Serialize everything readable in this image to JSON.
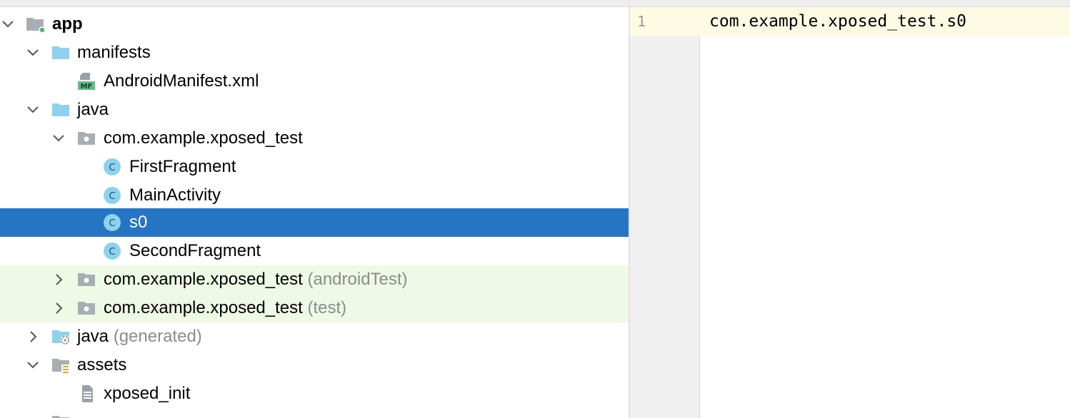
{
  "tree": {
    "rows": [
      {
        "label": "app",
        "suffix": "",
        "icon": "module-folder-icon",
        "expanded": true
      },
      {
        "label": "manifests",
        "suffix": "",
        "icon": "folder-icon",
        "expanded": true
      },
      {
        "label": "AndroidManifest.xml",
        "suffix": "",
        "icon": "manifest-file-icon",
        "badge": "MF"
      },
      {
        "label": "java",
        "suffix": "",
        "icon": "folder-icon",
        "expanded": true
      },
      {
        "label": "com.example.xposed_test",
        "suffix": "",
        "icon": "package-icon",
        "expanded": true
      },
      {
        "label": "FirstFragment",
        "suffix": "",
        "icon": "class-icon",
        "badge": "C"
      },
      {
        "label": "MainActivity",
        "suffix": "",
        "icon": "class-icon",
        "badge": "C"
      },
      {
        "label": "s0",
        "suffix": "",
        "icon": "class-icon",
        "badge": "C",
        "selected": true
      },
      {
        "label": "SecondFragment",
        "suffix": "",
        "icon": "class-icon",
        "badge": "C"
      },
      {
        "label": "com.example.xposed_test",
        "suffix": "(androidTest)",
        "icon": "package-icon",
        "expanded": false
      },
      {
        "label": "com.example.xposed_test",
        "suffix": "(test)",
        "icon": "package-icon",
        "expanded": false
      },
      {
        "label": "java",
        "suffix": "(generated)",
        "icon": "generated-folder-icon",
        "expanded": false
      },
      {
        "label": "assets",
        "suffix": "",
        "icon": "assets-folder-icon",
        "expanded": true
      },
      {
        "label": "xposed_init",
        "suffix": "",
        "icon": "text-file-icon"
      }
    ]
  },
  "editor": {
    "line_number": "1",
    "line_text": "com.example.xposed_test.s0"
  },
  "colors": {
    "selection": "#2675c4",
    "test_source_bg": "#eef9e6",
    "folder": "#8fd0ee",
    "class_icon": "#8bd3ee",
    "current_line": "#fefbe5"
  }
}
